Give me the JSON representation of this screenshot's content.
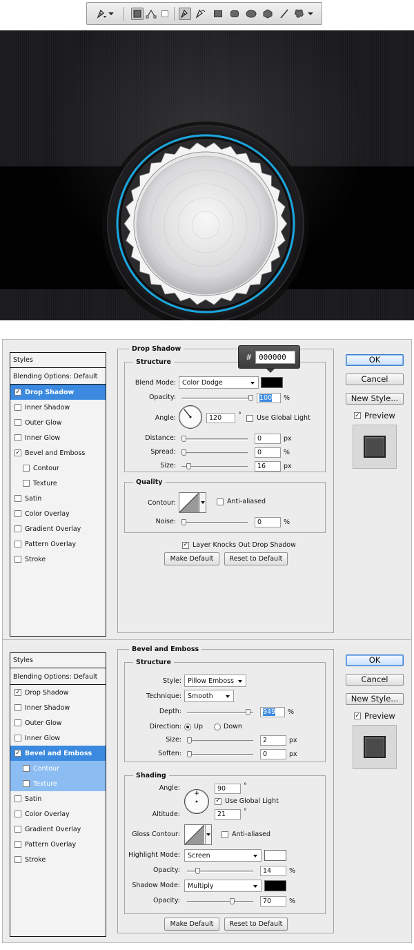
{
  "toolbar": {
    "tools": [
      "pen-tool-icon",
      "path-mode-icon",
      "shape-layer-icon",
      "fill-pixels-icon",
      "pen-icon",
      "freeform-pen-icon",
      "rectangle-icon",
      "rounded-rectangle-icon",
      "ellipse-icon",
      "polygon-icon",
      "line-icon",
      "custom-shape-icon"
    ]
  },
  "drop_shadow_dialog": {
    "styles_header": "Styles",
    "blending_options": "Blending Options: Default",
    "style_items": [
      {
        "label": "Drop Shadow",
        "checked": true,
        "selected": true
      },
      {
        "label": "Inner Shadow",
        "checked": false
      },
      {
        "label": "Outer Glow",
        "checked": false
      },
      {
        "label": "Inner Glow",
        "checked": false
      },
      {
        "label": "Bevel and Emboss",
        "checked": true
      },
      {
        "label": "Contour",
        "checked": false,
        "sub": true
      },
      {
        "label": "Texture",
        "checked": false,
        "sub": true
      },
      {
        "label": "Satin",
        "checked": false
      },
      {
        "label": "Color Overlay",
        "checked": false
      },
      {
        "label": "Gradient Overlay",
        "checked": false
      },
      {
        "label": "Pattern Overlay",
        "checked": false
      },
      {
        "label": "Stroke",
        "checked": false
      }
    ],
    "section_title": "Drop Shadow",
    "structure_title": "Structure",
    "blend_mode_label": "Blend Mode:",
    "blend_mode_value": "Color Dodge",
    "color_tooltip_hash": "#",
    "color_tooltip_value": "000000",
    "opacity_label": "Opacity:",
    "opacity_value": "100",
    "opacity_unit": "%",
    "angle_label": "Angle:",
    "angle_value": "120",
    "angle_unit": "°",
    "use_global_light": "Use Global Light",
    "distance_label": "Distance:",
    "distance_value": "0",
    "distance_unit": "px",
    "spread_label": "Spread:",
    "spread_value": "0",
    "spread_unit": "%",
    "size_label": "Size:",
    "size_value": "16",
    "size_unit": "px",
    "quality_title": "Quality",
    "contour_label": "Contour:",
    "anti_aliased": "Anti-aliased",
    "noise_label": "Noise:",
    "noise_value": "0",
    "noise_unit": "%",
    "layer_knocks_out": "Layer Knocks Out Drop Shadow",
    "make_default": "Make Default",
    "reset_default": "Reset to Default",
    "ok": "OK",
    "cancel": "Cancel",
    "new_style": "New Style...",
    "preview": "Preview",
    "shadow_color": "#000000",
    "slider_levels": {
      "opacity": 1.0,
      "distance": 0.0,
      "spread": 0.0,
      "size": 0.08,
      "noise": 0.0
    }
  },
  "bevel_dialog": {
    "styles_header": "Styles",
    "blending_options": "Blending Options: Default",
    "style_items": [
      {
        "label": "Drop Shadow",
        "checked": true
      },
      {
        "label": "Inner Shadow",
        "checked": false
      },
      {
        "label": "Outer Glow",
        "checked": false
      },
      {
        "label": "Inner Glow",
        "checked": false
      },
      {
        "label": "Bevel and Emboss",
        "checked": true,
        "selected": true
      },
      {
        "label": "Contour",
        "checked": false,
        "sub": true
      },
      {
        "label": "Texture",
        "checked": false,
        "sub": true
      },
      {
        "label": "Satin",
        "checked": false
      },
      {
        "label": "Color Overlay",
        "checked": false
      },
      {
        "label": "Gradient Overlay",
        "checked": false
      },
      {
        "label": "Pattern Overlay",
        "checked": false
      },
      {
        "label": "Stroke",
        "checked": false
      }
    ],
    "section_title": "Bevel and Emboss",
    "structure_title": "Structure",
    "style_label": "Style:",
    "style_value": "Pillow Emboss",
    "technique_label": "Technique:",
    "technique_value": "Smooth",
    "depth_label": "Depth:",
    "depth_value": "949",
    "depth_unit": "%",
    "direction_label": "Direction:",
    "direction_up": "Up",
    "direction_down": "Down",
    "size_label": "Size:",
    "size_value": "2",
    "size_unit": "px",
    "soften_label": "Soften:",
    "soften_value": "0",
    "soften_unit": "px",
    "shading_title": "Shading",
    "angle_label": "Angle:",
    "angle_value": "90",
    "angle_unit": "°",
    "use_global_light": "Use Global Light",
    "altitude_label": "Altitude:",
    "altitude_value": "21",
    "altitude_unit": "°",
    "gloss_contour_label": "Gloss Contour:",
    "anti_aliased": "Anti-aliased",
    "highlight_mode_label": "Highlight Mode:",
    "highlight_mode_value": "Screen",
    "highlight_opacity_label": "Opacity:",
    "highlight_opacity_value": "14",
    "highlight_opacity_unit": "%",
    "shadow_mode_label": "Shadow Mode:",
    "shadow_mode_value": "Multiply",
    "shadow_opacity_label": "Opacity:",
    "shadow_opacity_value": "70",
    "shadow_opacity_unit": "%",
    "make_default": "Make Default",
    "reset_default": "Reset to Default",
    "ok": "OK",
    "cancel": "Cancel",
    "new_style": "New Style...",
    "preview": "Preview",
    "highlight_color": "#ffffff",
    "shadow_color": "#000000",
    "slider_levels": {
      "depth": 0.95,
      "size": 0.0,
      "soften": 0.0,
      "highlight_opacity": 0.14,
      "shadow_opacity": 0.7
    }
  },
  "colors": {
    "accent_blue": "#3b8ae0",
    "knob_ring": "#1aa7e0"
  }
}
